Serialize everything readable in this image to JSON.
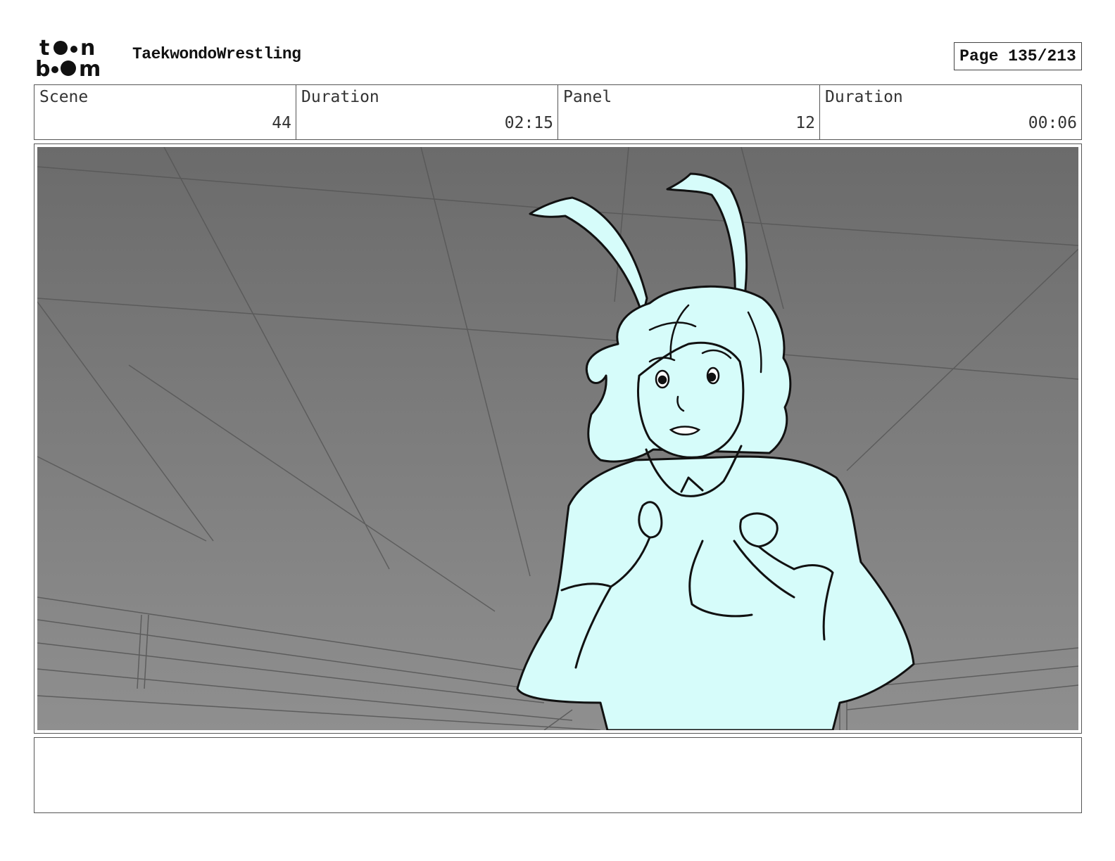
{
  "header": {
    "logo_alt": "toon boom",
    "logo_icon": "toon-boom-logo",
    "project_title": "TaekwondoWrestling",
    "page_label": "Page 135/213"
  },
  "info": {
    "scene_label": "Scene",
    "scene_value": "44",
    "scene_duration_label": "Duration",
    "scene_duration_value": "02:15",
    "panel_label": "Panel",
    "panel_value": "12",
    "panel_duration_label": "Duration",
    "panel_duration_value": "00:06"
  },
  "colors": {
    "background_top": "#6b6b6b",
    "background_bottom": "#8f8f8f",
    "character_fill": "#d6fcfa",
    "line": "#111111"
  },
  "notes": {
    "text": ""
  }
}
